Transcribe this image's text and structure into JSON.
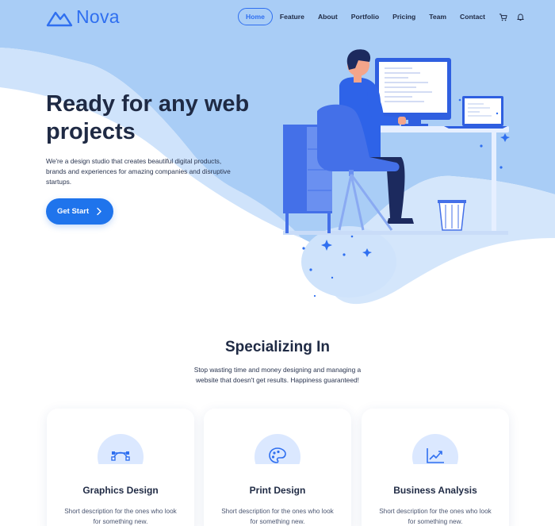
{
  "brand": {
    "name": "Nova",
    "logo_icon": "mountain-logo-icon",
    "accent": "#2f6ff0"
  },
  "nav": {
    "items": [
      {
        "label": "Home",
        "active": true
      },
      {
        "label": "Feature",
        "active": false
      },
      {
        "label": "About",
        "active": false
      },
      {
        "label": "Portfolio",
        "active": false
      },
      {
        "label": "Pricing",
        "active": false
      },
      {
        "label": "Team",
        "active": false
      },
      {
        "label": "Contact",
        "active": false
      }
    ],
    "icons": [
      "cart-icon",
      "bell-icon"
    ]
  },
  "hero": {
    "title": "Ready for any web projects",
    "description": "We're a design studio that creates beautiful digital products, brands and experiences for amazing companies and disruptive startups.",
    "cta_label": "Get Start",
    "cta_icon": "chevron-right-icon",
    "background_color": "#a9cdf6",
    "illustration": "person-at-desk-illustration"
  },
  "services": {
    "title": "Specializing In",
    "subtitle": "Stop wasting time and money designing and managing a website that doesn't get results. Happiness guaranteed!",
    "cards": [
      {
        "title": "Graphics Design",
        "description": "Short description for the ones who look for something new.",
        "icon": "vector-nodes-icon"
      },
      {
        "title": "Print Design",
        "description": "Short description for the ones who look for something new.",
        "icon": "palette-icon"
      },
      {
        "title": "Business Analysis",
        "description": "Short description for the ones who look for something new.",
        "icon": "chart-growth-icon"
      }
    ]
  }
}
